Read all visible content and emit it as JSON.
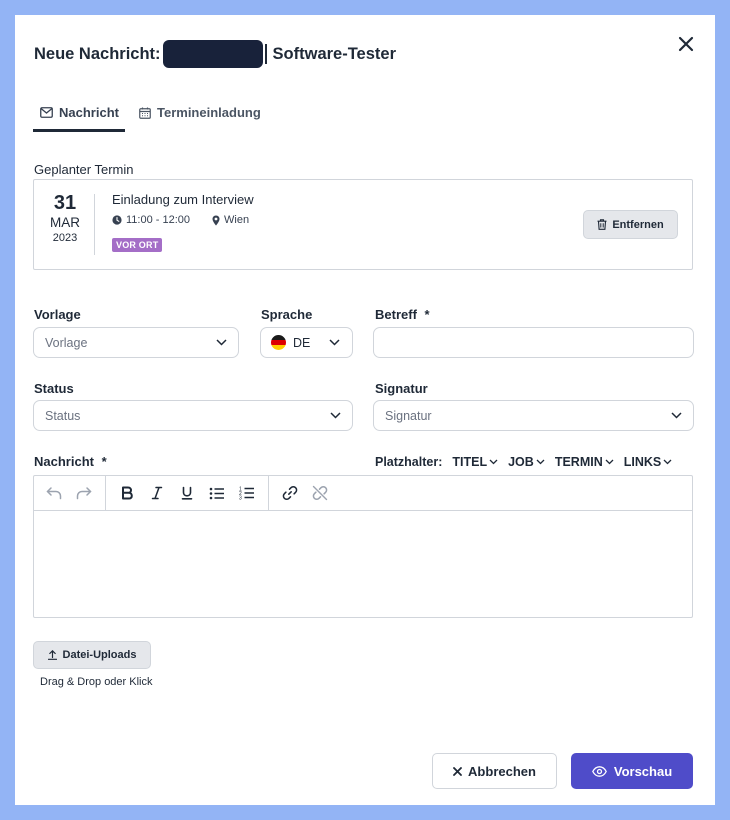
{
  "dialog": {
    "title_prefix": "Neue Nachricht:",
    "title_suffix": "Software-Tester"
  },
  "tabs": [
    {
      "label": "Nachricht",
      "icon": "mail-icon",
      "active": true
    },
    {
      "label": "Termineinladung",
      "icon": "calendar-icon",
      "active": false
    }
  ],
  "appointment": {
    "section_label": "Geplanter Termin",
    "day": "31",
    "month": "MAR",
    "year": "2023",
    "title": "Einladung zum Interview",
    "time": "11:00 - 12:00",
    "location": "Wien",
    "badge": "VOR ORT",
    "badge_color": "#a46ec7",
    "remove_label": "Entfernen"
  },
  "form": {
    "template_label": "Vorlage",
    "template_placeholder": "Vorlage",
    "language_label": "Sprache",
    "language_value": "DE",
    "subject_label": "Betreff",
    "required_mark": "*",
    "status_label": "Status",
    "status_placeholder": "Status",
    "signature_label": "Signatur",
    "signature_placeholder": "Signatur",
    "message_label": "Nachricht"
  },
  "placeholders": {
    "label": "Platzhalter:",
    "items": [
      "TITEL",
      "JOB",
      "TERMIN",
      "LINKS"
    ]
  },
  "upload": {
    "button_label": "Datei-Uploads",
    "hint": "Drag & Drop oder Klick"
  },
  "footer": {
    "cancel_label": "Abbrechen",
    "preview_label": "Vorschau",
    "primary_color": "#4f4cc9"
  }
}
